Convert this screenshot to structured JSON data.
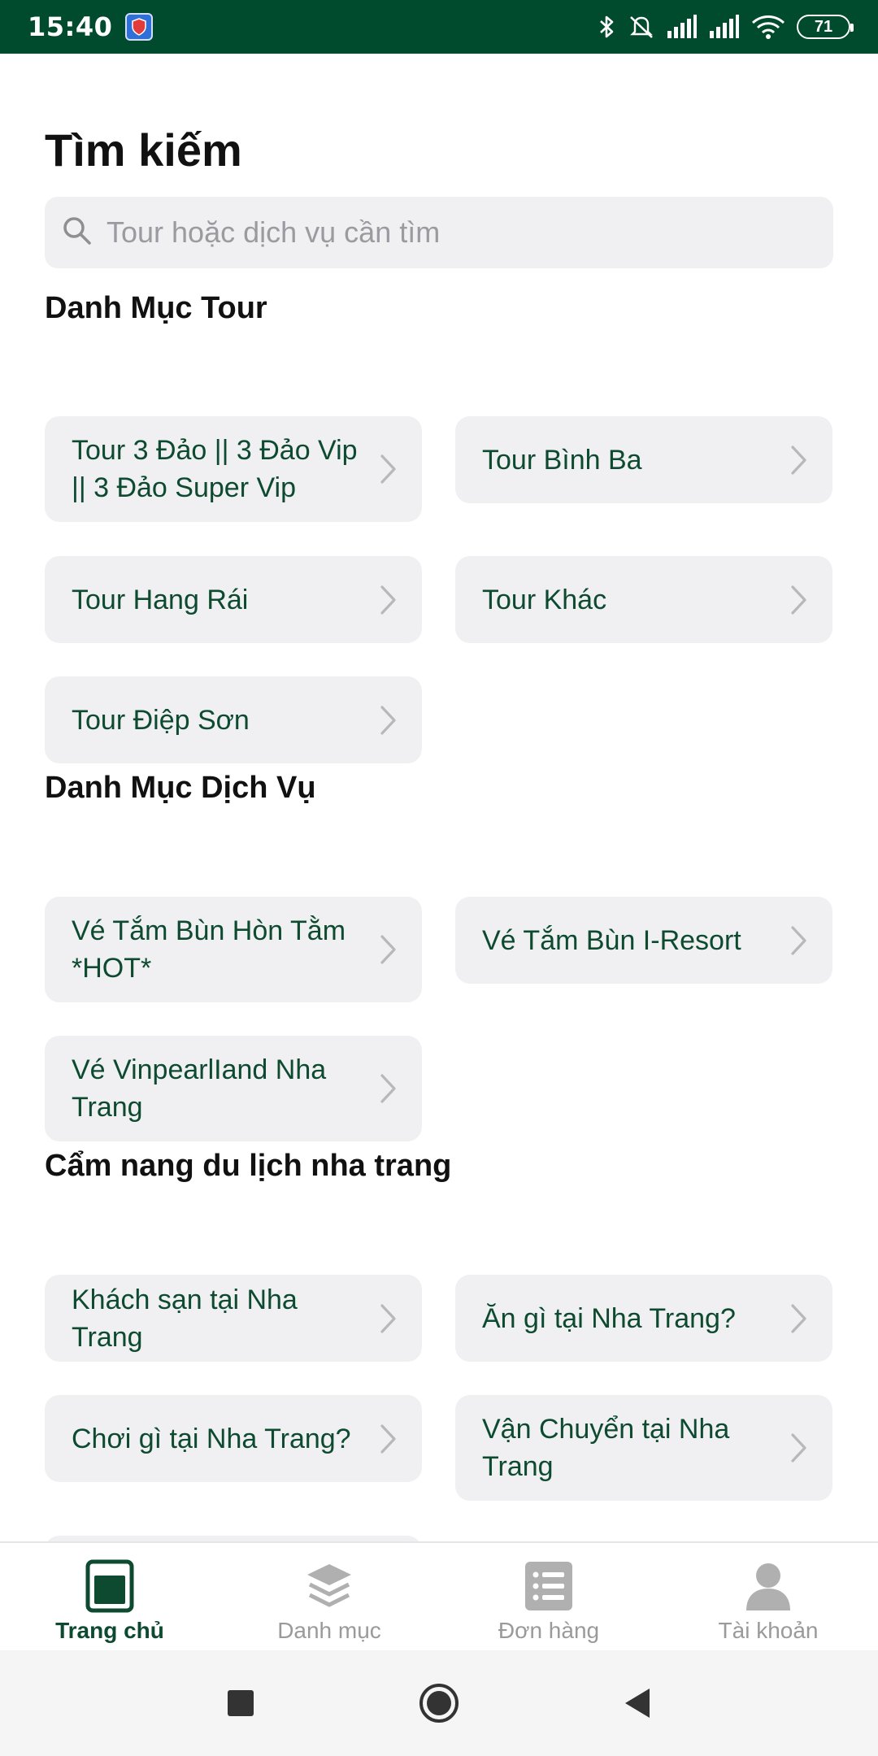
{
  "status_bar": {
    "time": "15:40",
    "battery": "71"
  },
  "page": {
    "title": "Tìm kiếm"
  },
  "search": {
    "placeholder": "Tour hoặc dịch vụ cần tìm"
  },
  "sections": [
    {
      "title": "Danh Mục Tour",
      "items": [
        "Tour 3 Đảo || 3 Đảo Vip || 3 Đảo Super Vip",
        "Tour Bình Ba",
        "Tour Hang Rái",
        "Tour Khác",
        "Tour Điệp Sơn"
      ]
    },
    {
      "title": "Danh Mục Dịch Vụ",
      "items": [
        "Vé Tắm Bùn Hòn Tằm *HOT*",
        "Vé Tắm Bùn I-Resort",
        "Vé VinpearlIand Nha Trang"
      ]
    },
    {
      "title": "Cẩm nang du lịch nha trang",
      "items": [
        "Khách sạn tại Nha Trang",
        "Ăn gì tại Nha Trang?",
        "Chơi gì tại Nha Trang?",
        "Vận Chuyển tại Nha Trang"
      ]
    }
  ],
  "tabs": [
    {
      "label": "Trang chủ",
      "icon": "home-icon",
      "active": true
    },
    {
      "label": "Danh mục",
      "icon": "layers-icon",
      "active": false
    },
    {
      "label": "Đơn hàng",
      "icon": "list-icon",
      "active": false
    },
    {
      "label": "Tài khoản",
      "icon": "user-icon",
      "active": false
    }
  ],
  "colors": {
    "brand": "#004a2d",
    "card_text": "#0d4a30",
    "card_bg": "#f0f0f2"
  }
}
